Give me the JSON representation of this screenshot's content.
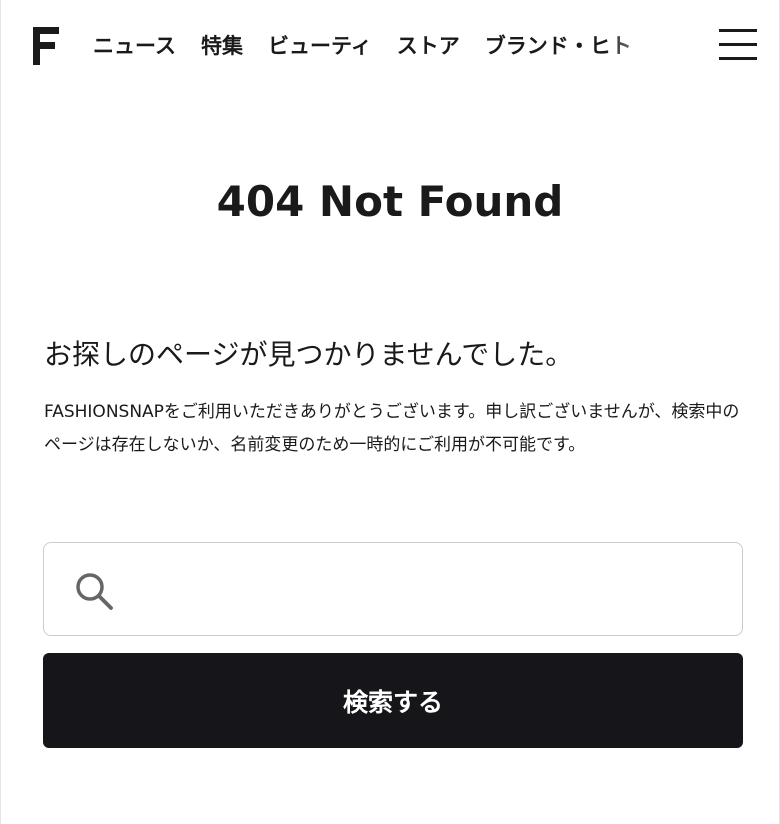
{
  "header": {
    "logo": "F",
    "nav": [
      {
        "label": "ニュース"
      },
      {
        "label": "特集"
      },
      {
        "label": "ビューティ"
      },
      {
        "label": "ストア"
      },
      {
        "label": "ブランド・ヒト"
      }
    ],
    "menu_icon": "hamburger-menu-icon"
  },
  "main": {
    "title": "404 Not Found",
    "subtitle": "お探しのページが見つかりませんでした。",
    "description": "FASHIONSNAPをご利用いただきありがとうございます。申し訳ございませんが、検索中のページは存在しないか、名前変更のため一時的にご利用が不可能です。"
  },
  "search": {
    "icon": "search-icon",
    "value": "",
    "placeholder": "",
    "button_label": "検索する"
  },
  "colors": {
    "text": "#1a1a1a",
    "button_bg": "#16161a",
    "button_text": "#ffffff",
    "input_border": "#cccccc",
    "icon": "#666666"
  }
}
